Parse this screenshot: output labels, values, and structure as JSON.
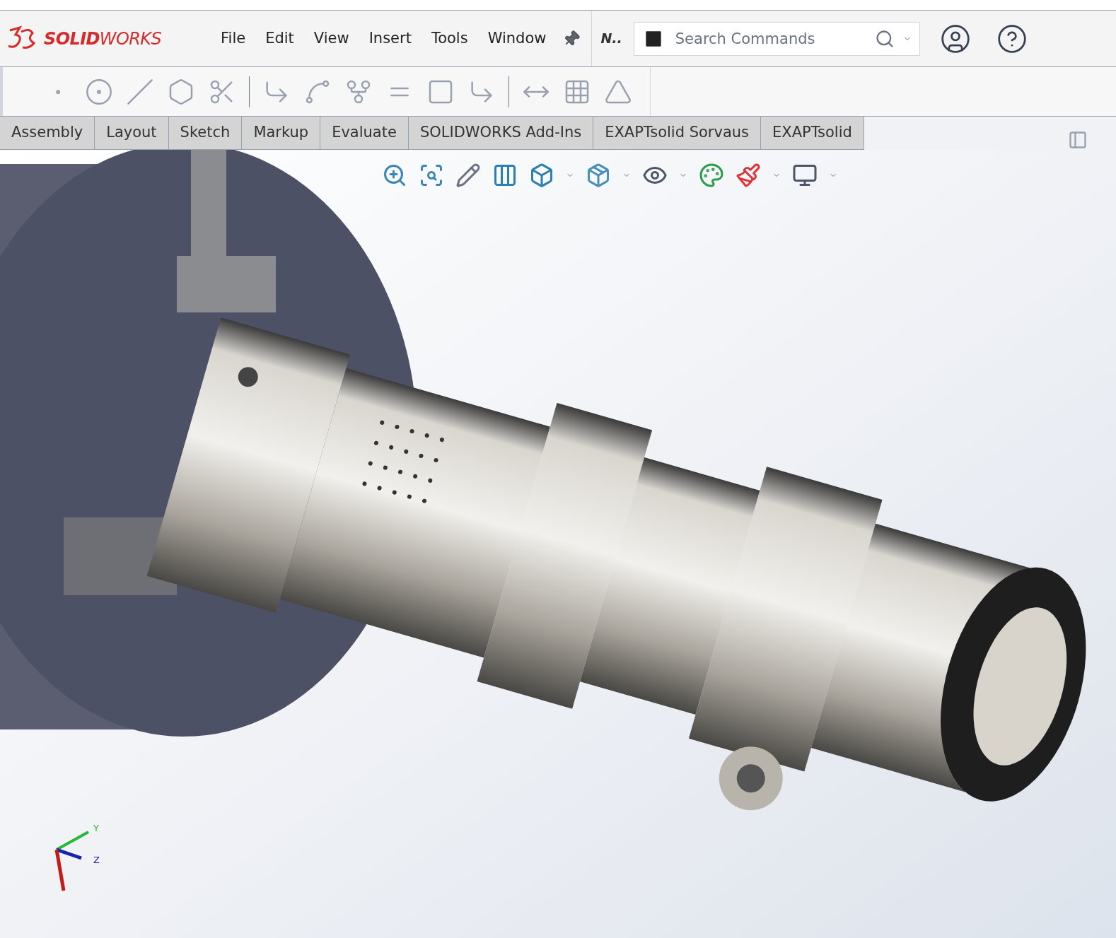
{
  "app": {
    "logo": "**SOLID**WORKS"
  },
  "menu": [
    {
      "label": "File"
    },
    {
      "label": "Edit"
    },
    {
      "label": "View"
    },
    {
      "label": "Insert"
    },
    {
      "label": "Tools"
    },
    {
      "label": "Window"
    }
  ],
  "document_name": "N..",
  "search": {
    "placeholder": "Search Commands"
  },
  "tabs": [
    {
      "label": "Assembly",
      "selected": false
    },
    {
      "label": "Layout",
      "selected": false
    },
    {
      "label": "Sketch",
      "selected": false
    },
    {
      "label": "Markup",
      "selected": false
    },
    {
      "label": "Evaluate",
      "selected": false
    },
    {
      "label": "SOLIDWORKS Add-Ins",
      "selected": false
    },
    {
      "label": "EXAPTsolid Sorvaus",
      "selected": false
    },
    {
      "label": "EXAPTsolid",
      "selected": false
    }
  ],
  "triad": {
    "y_label": "Y",
    "z_label": "Z"
  }
}
